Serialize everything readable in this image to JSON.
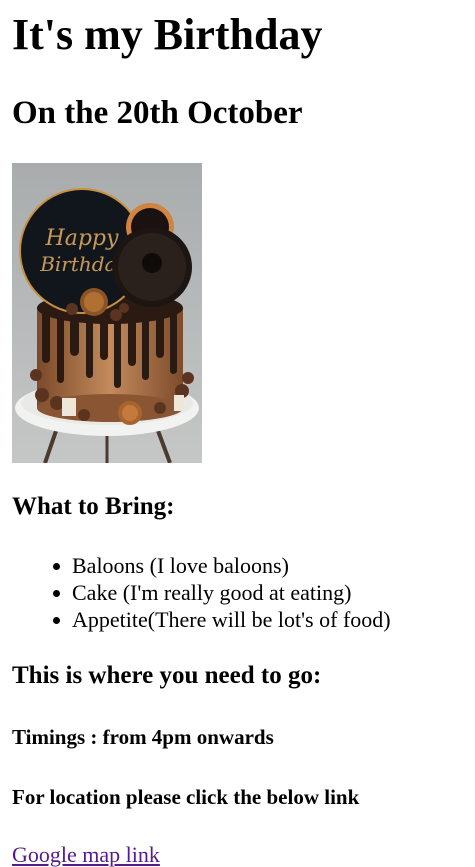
{
  "header": {
    "title": "It's my Birthday",
    "date": "On the 20th October"
  },
  "image": {
    "alt": "Happy Birthday cake",
    "topper_line1": "Happy",
    "topper_line2": "Birthday"
  },
  "bring": {
    "heading": "What to Bring:",
    "items": [
      "Baloons (I love baloons)",
      "Cake (I'm really good at eating)",
      "Appetite(There will be lot's of food)"
    ]
  },
  "directions": {
    "heading": "This is where you need to go:",
    "timings": "Timings : from 4pm onwards",
    "location_note": "For location please click the below link",
    "map_link_label": "Google map link"
  },
  "colors": {
    "link_visited": "#551a8b",
    "text": "#000000",
    "background": "#ffffff"
  }
}
